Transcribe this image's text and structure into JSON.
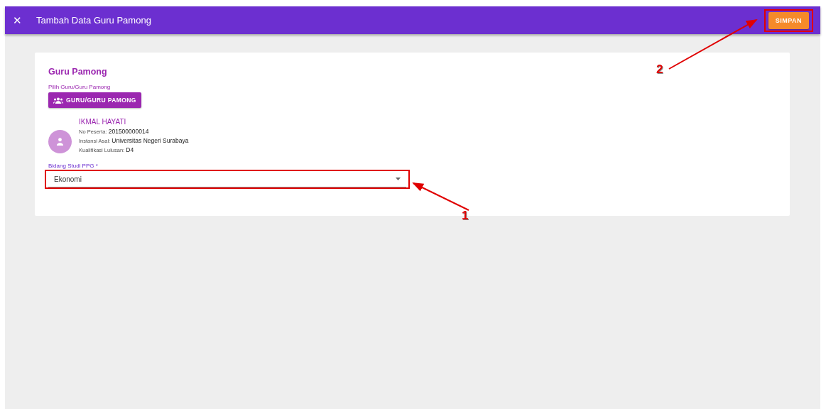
{
  "app_bar": {
    "close": "✕",
    "title": "Tambah Data Guru Pamong",
    "save_button": "SIMPAN"
  },
  "card": {
    "title": "Guru Pamong",
    "picker_label": "Pilih Guru/Guru Pamong",
    "picker_button": "GURU/GURU PAMONG",
    "person": {
      "name": "IKMAL HAYATI",
      "fields": [
        {
          "label": "No Peserta:",
          "value": "201500000014"
        },
        {
          "label": "Instansi Asal:",
          "value": "Universitas Negeri Surabaya"
        },
        {
          "label": "Kualifikasi Lulusan:",
          "value": "D4"
        }
      ]
    },
    "select": {
      "label": "Bidang Studi PPG *",
      "value": "Ekonomi"
    }
  },
  "annotations": [
    {
      "number": "1",
      "kind": "select"
    },
    {
      "number": "2",
      "kind": "save"
    }
  ]
}
